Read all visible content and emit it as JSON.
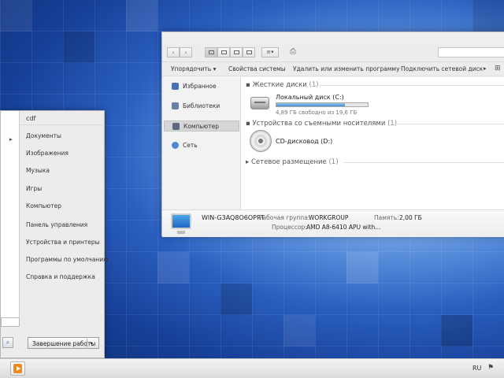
{
  "explorer": {
    "toolbar": {
      "organize": "Упорядочить ▾",
      "system_properties": "Свойства системы",
      "uninstall": "Удалить или изменить программу",
      "map_drive": "Подключить сетевой диск",
      "overflow_arrow": "▸"
    },
    "nav_pane": [
      {
        "label": "Избранное",
        "icon": "star-icon",
        "color": "#4a6fb0"
      },
      {
        "label": "Библиотеки",
        "icon": "library-icon",
        "color": "#6b7fa6"
      },
      {
        "label": "Компьютер",
        "icon": "computer-icon",
        "color": "#5c6a80",
        "selected": true
      },
      {
        "label": "Сеть",
        "icon": "network-icon",
        "color": "#4d8bd0"
      }
    ],
    "groups": {
      "hard_drives": {
        "title": "Жесткие диски",
        "count": "(1)"
      },
      "removable": {
        "title": "Устройства со съемными носителями",
        "count": "(1)"
      },
      "network": {
        "title": "Сетевое размещение",
        "count": "(1)"
      }
    },
    "drives": {
      "c": {
        "name": "Локальный диск (C:)",
        "free_text": "4,89 ГБ свободно из 19,6 ГБ",
        "used_fraction": 0.75
      },
      "d": {
        "name": "CD-дисковод (D:)"
      }
    },
    "details": {
      "computer_name": "WIN-G3AQ8O6OPRT",
      "workgroup_label": "Рабочая группа:",
      "workgroup_value": "WORKGROUP",
      "memory_label": "Память:",
      "memory_value": "2,00 ГБ",
      "cpu_label": "Процессор:",
      "cpu_value": "AMD A8-6410 APU with..."
    }
  },
  "start_menu": {
    "user": "cdf",
    "items": [
      "Документы",
      "Изображения",
      "Музыка",
      "Игры",
      "Компьютер",
      "Панель управления",
      "Устройства и принтеры",
      "Программы по умолчанию",
      "Справка и поддержка"
    ],
    "shutdown_label": "Завершение работы",
    "arrow": "▸"
  },
  "taskbar": {
    "language": "RU",
    "pinned_app_icon": "media-player-icon",
    "flag_icon": "action-center-flag-icon"
  }
}
